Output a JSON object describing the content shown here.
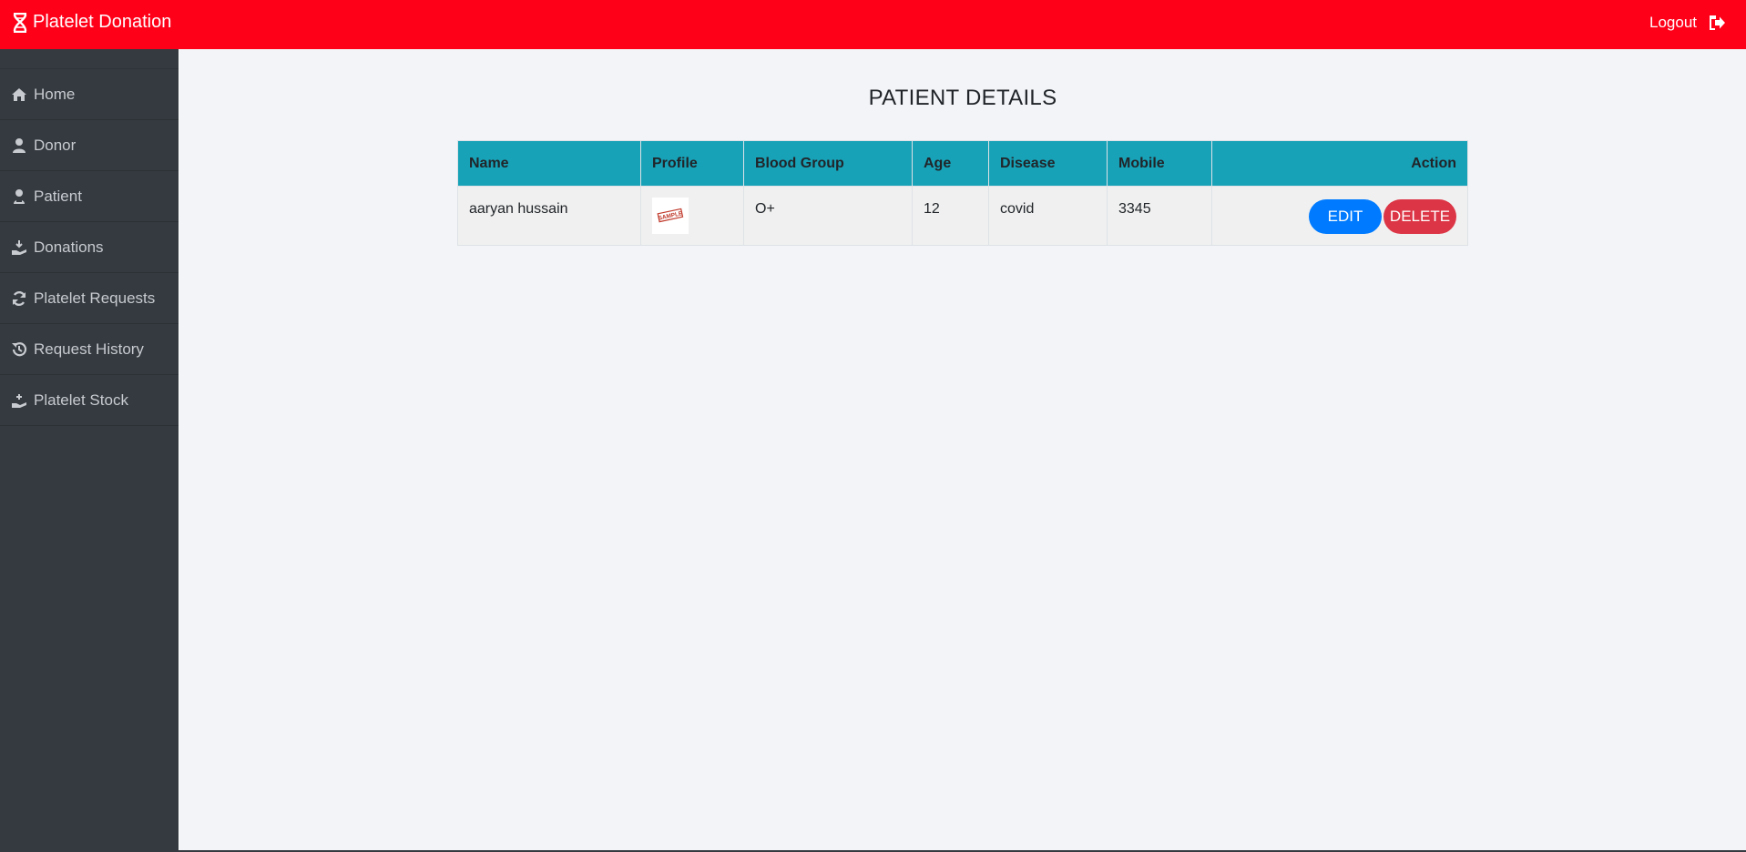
{
  "header": {
    "brand_title": "Platelet Donation",
    "brand_icon": "dna-icon",
    "logout_label": "Logout",
    "logout_icon": "sign-out-icon",
    "bg_color": "#ff0019"
  },
  "sidebar": {
    "bg_color": "#343a40",
    "items": [
      {
        "label": "Home",
        "icon": "home-icon"
      },
      {
        "label": "Donor",
        "icon": "user-icon"
      },
      {
        "label": "Patient",
        "icon": "user-injured-icon"
      },
      {
        "label": "Donations",
        "icon": "hand-holding-icon"
      },
      {
        "label": "Platelet Requests",
        "icon": "sync-icon"
      },
      {
        "label": "Request History",
        "icon": "history-icon"
      },
      {
        "label": "Platelet Stock",
        "icon": "hand-holding-medical-icon"
      }
    ]
  },
  "main": {
    "page_title": "PATIENT DETAILS",
    "table": {
      "header_color": "#17a2b8",
      "columns": [
        "Name",
        "Profile",
        "Blood Group",
        "Age",
        "Disease",
        "Mobile",
        "Action"
      ],
      "rows": [
        {
          "name": "aaryan hussain",
          "profile_image_text": "SAMPLE",
          "blood_group": "O+",
          "age": "12",
          "disease": "covid",
          "mobile": "3345",
          "edit_label": "EDIT",
          "delete_label": "DELETE"
        }
      ]
    },
    "edit_color": "#007bff",
    "delete_color": "#dc3545"
  }
}
